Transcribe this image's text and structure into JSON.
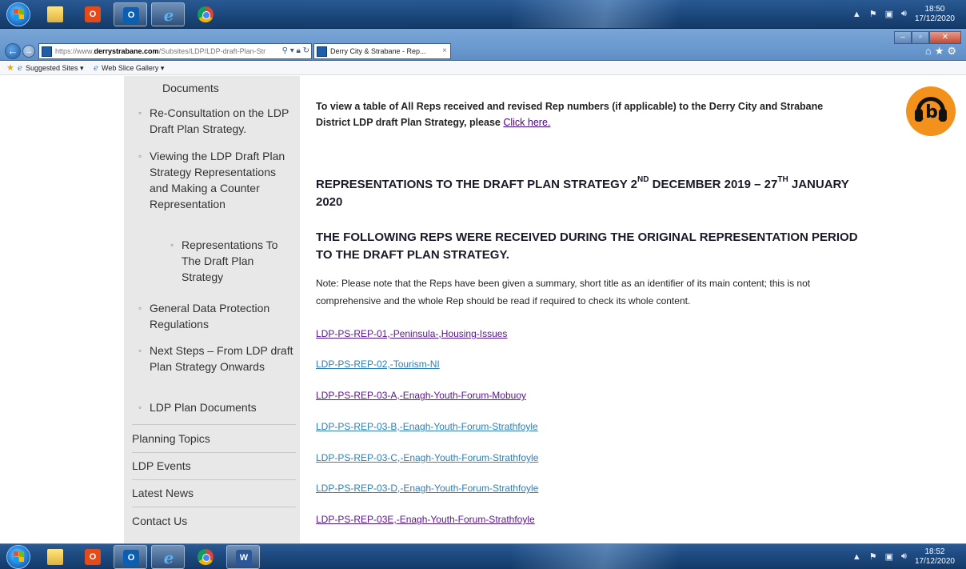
{
  "top_taskbar": {
    "clock_time": "18:50",
    "clock_date": "17/12/2020"
  },
  "bottom_taskbar": {
    "clock_time": "18:52",
    "clock_date": "17/12/2020"
  },
  "browser": {
    "url_scheme": "https://www.",
    "url_domain": "derrystrabane.com",
    "url_path": "/Subsites/LDP/LDP-draft-Plan-Str",
    "tab_title": "Derry City & Strabane - Rep...",
    "tab_close": "×",
    "favorites": {
      "suggested_sites": "Suggested Sites ▾",
      "web_slice_gallery": "Web Slice Gallery ▾"
    }
  },
  "sidebar": {
    "documents": "Documents",
    "re_consultation": "Re-Consultation on the LDP Draft Plan Strategy.",
    "viewing": "Viewing the LDP Draft Plan Strategy Representations and Making a Counter Representation",
    "representations": "Representations To The Draft Plan Strategy",
    "gdpr": "General Data Protection Regulations",
    "next_steps": "Next Steps – From LDP draft Plan Strategy Onwards",
    "plan_documents": "LDP Plan Documents",
    "planning_topics": "Planning Topics",
    "ldp_events": "LDP Events",
    "latest_news": "Latest News",
    "contact_us": "Contact Us"
  },
  "main": {
    "intro_text": "To view a table of All Reps received and revised Rep numbers (if applicable) to the Derry City and Strabane District LDP draft Plan Strategy, please ",
    "intro_link": "Click here.",
    "heading1_a": "REPRESENTATIONS TO THE DRAFT PLAN STRATEGY 2",
    "heading1_sup1": "ND",
    "heading1_b": " DECEMBER 2019 – 27",
    "heading1_sup2": "TH",
    "heading1_c": " JANUARY 2020",
    "heading2": "THE FOLLOWING REPS WERE RECEIVED DURING THE ORIGINAL REPRESENTATION PERIOD TO THE DRAFT PLAN STRATEGY.",
    "note": "Note: Please note that the Reps have been given a summary, short title as an identifier of its main content; this is not comprehensive and the whole Rep should be read if required to check its whole content.",
    "reps": [
      "LDP-PS-REP-01,-Peninsula-,Housing-Issues",
      "LDP-PS-REP-02,-Tourism-NI",
      "LDP-PS-REP-03-A,-Enagh-Youth-Forum-Mobuoy",
      "LDP-PS-REP-03-B,-Enagh-Youth-Forum-Strathfoyle",
      "LDP-PS-REP-03-C,-Enagh-Youth-Forum-Strathfoyle",
      "LDP-PS-REP-03-D,-Enagh-Youth-Forum-Strathfoyle",
      "LDP-PS-REP-03E,-Enagh-Youth-Forum-Strathfoyle"
    ]
  }
}
